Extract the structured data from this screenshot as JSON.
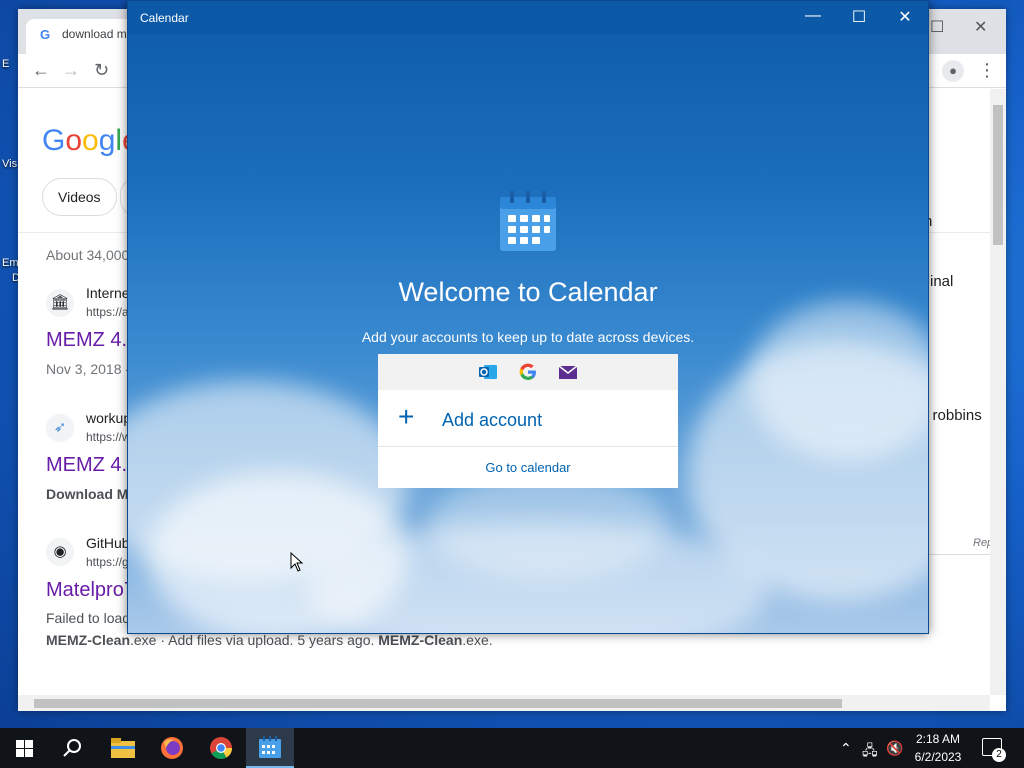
{
  "desktop": {
    "icon_labels": [
      "E",
      "Vis",
      "Em",
      "D"
    ]
  },
  "chrome": {
    "tab_title": "download m",
    "search_logo": "Google",
    "chip_videos": "Videos",
    "about": "About 34,000",
    "results": [
      {
        "site": "Interne",
        "url": "https://a",
        "title": "MEMZ 4.",
        "meta": "Nov 3, 2018 -"
      },
      {
        "site": "workup",
        "url": "https://w",
        "title": "MEMZ 4.",
        "meta": "Download M"
      },
      {
        "site": "GitHub",
        "url": "https://g",
        "title": "Matelpro7",
        "meta": "Failed to load"
      }
    ],
    "snippet_bold_1": "MEMZ-Clean",
    "snippet_text_1": ".exe · Add files via upload. 5 years ago.",
    "snippet_bold_2": "MEMZ-Clean",
    "snippet_text_2": ".exe.",
    "side_texts": [
      "n",
      "inal",
      "n robbins",
      "Rep"
    ]
  },
  "calendar": {
    "title": "Calendar",
    "welcome": "Welcome to Calendar",
    "subtitle": "Add your accounts to keep up to date across devices.",
    "add_account": "Add account",
    "go_to_calendar": "Go to calendar",
    "accent": "#0063b1"
  },
  "taskbar": {
    "time": "2:18 AM",
    "date": "6/2/2023",
    "notification_count": "2",
    "apps": [
      "start-icon",
      "search-icon",
      "file-explorer-icon",
      "firefox-icon",
      "chrome-icon",
      "calendar-icon"
    ]
  }
}
